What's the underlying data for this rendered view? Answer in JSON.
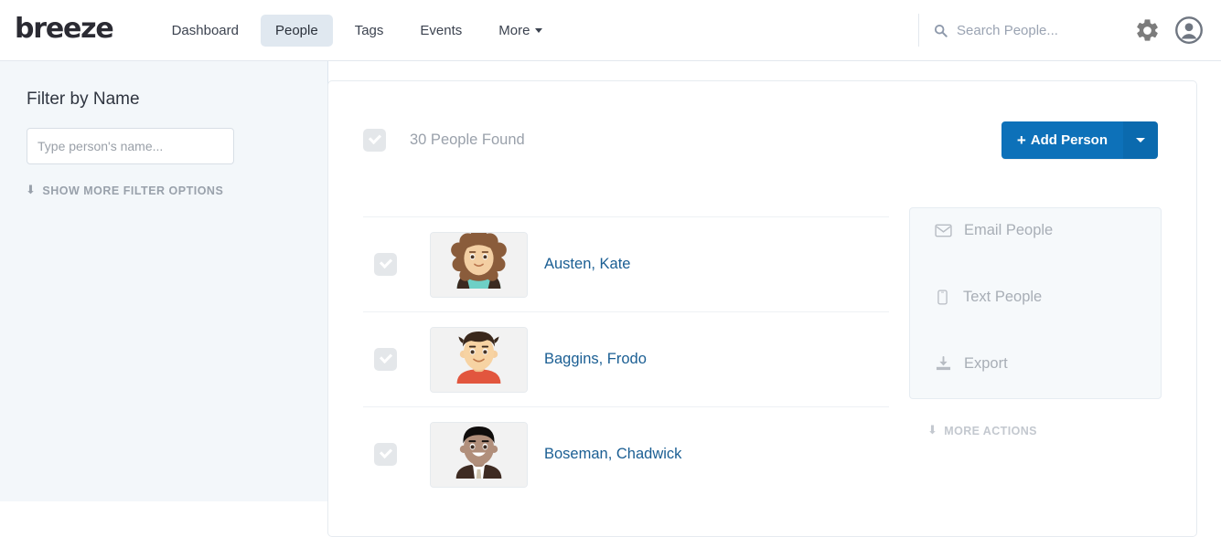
{
  "header": {
    "logo": "breeze",
    "nav": [
      {
        "label": "Dashboard",
        "active": false,
        "caret": false
      },
      {
        "label": "People",
        "active": true,
        "caret": false
      },
      {
        "label": "Tags",
        "active": false,
        "caret": false
      },
      {
        "label": "Events",
        "active": false,
        "caret": false
      },
      {
        "label": "More",
        "active": false,
        "caret": true
      }
    ],
    "search": {
      "placeholder": "Search People...",
      "value": "",
      "icon": "search-icon"
    },
    "gear_icon": "gear-icon",
    "account_icon": "user-avatar-icon"
  },
  "sidebar": {
    "title": "Filter by Name",
    "name_filter": {
      "placeholder": "Type person's name...",
      "value": ""
    },
    "show_more": {
      "label": "SHOW MORE FILTER OPTIONS",
      "icon": "arrow-down-icon",
      "glyph": "⬇"
    }
  },
  "main": {
    "select_all_checked": true,
    "results_label": "30 People Found",
    "add_person": {
      "label": "Add Person",
      "plus": "+",
      "dropdown_icon": "caret-down-icon"
    },
    "people": [
      {
        "name": "Austen, Kate",
        "checked": true,
        "avatar": "woman-curly-brown-hair"
      },
      {
        "name": "Baggins, Frodo",
        "checked": true,
        "avatar": "boy-dark-hair-red-shirt"
      },
      {
        "name": "Boseman, Chadwick",
        "checked": true,
        "avatar": "man-black-hair-suit"
      }
    ]
  },
  "actions": {
    "items": [
      {
        "label": "Email People",
        "icon": "envelope-icon"
      },
      {
        "label": "Text People",
        "icon": "mobile-phone-icon"
      },
      {
        "label": "Export",
        "icon": "download-icon"
      }
    ],
    "more": {
      "label": "MORE ACTIONS",
      "icon": "arrow-down-icon",
      "glyph": "⬇"
    }
  },
  "colors": {
    "accent_blue": "#0d71b9",
    "accent_blue_dark": "#0b6aae",
    "link_blue": "#1a5e93",
    "sidebar_bg": "#f3f7fa",
    "muted_text": "#9aa1ab",
    "checkbox_bg": "#e4e7ea"
  }
}
